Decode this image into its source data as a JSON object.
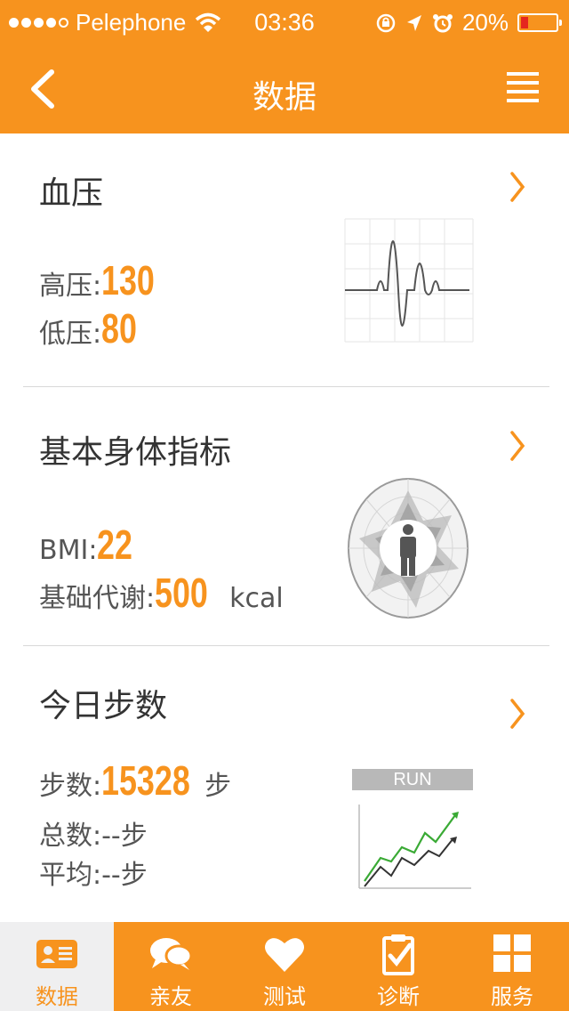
{
  "status_bar": {
    "carrier": "Pelephone",
    "time": "03:36",
    "battery_percent": "20%",
    "battery_level": 0.2,
    "signal_bars": 4
  },
  "nav": {
    "title": "数据",
    "back_icon": "chevron-left-icon",
    "menu_icon": "hamburger-icon"
  },
  "blood_pressure": {
    "title": "血压",
    "high_label": "高压:",
    "high_value": "130",
    "low_label": "低压:",
    "low_value": "80"
  },
  "body_index": {
    "title": "基本身体指标",
    "bmi_label": "BMI:",
    "bmi_value": "22",
    "metabolism_label": "基础代谢:",
    "metabolism_value": "500",
    "metabolism_unit": "kcal"
  },
  "steps": {
    "title": "今日步数",
    "steps_label": "步数:",
    "steps_value": "15328",
    "steps_unit": "步",
    "total_label": "总数:",
    "total_value": "--",
    "total_unit": "步",
    "avg_label": "平均:",
    "avg_value": "--",
    "avg_unit": "步",
    "run_badge": "RUN"
  },
  "tabs": [
    {
      "label": "数据",
      "icon": "id-card-icon",
      "active": true
    },
    {
      "label": "亲友",
      "icon": "chat-bubbles-icon",
      "active": false
    },
    {
      "label": "测试",
      "icon": "heart-icon",
      "active": false
    },
    {
      "label": "诊断",
      "icon": "clipboard-check-icon",
      "active": false
    },
    {
      "label": "服务",
      "icon": "grid-icon",
      "active": false
    }
  ],
  "colors": {
    "accent": "#f7931e",
    "active_tab_bg": "#efeff0",
    "battery_low": "#e5261f"
  }
}
